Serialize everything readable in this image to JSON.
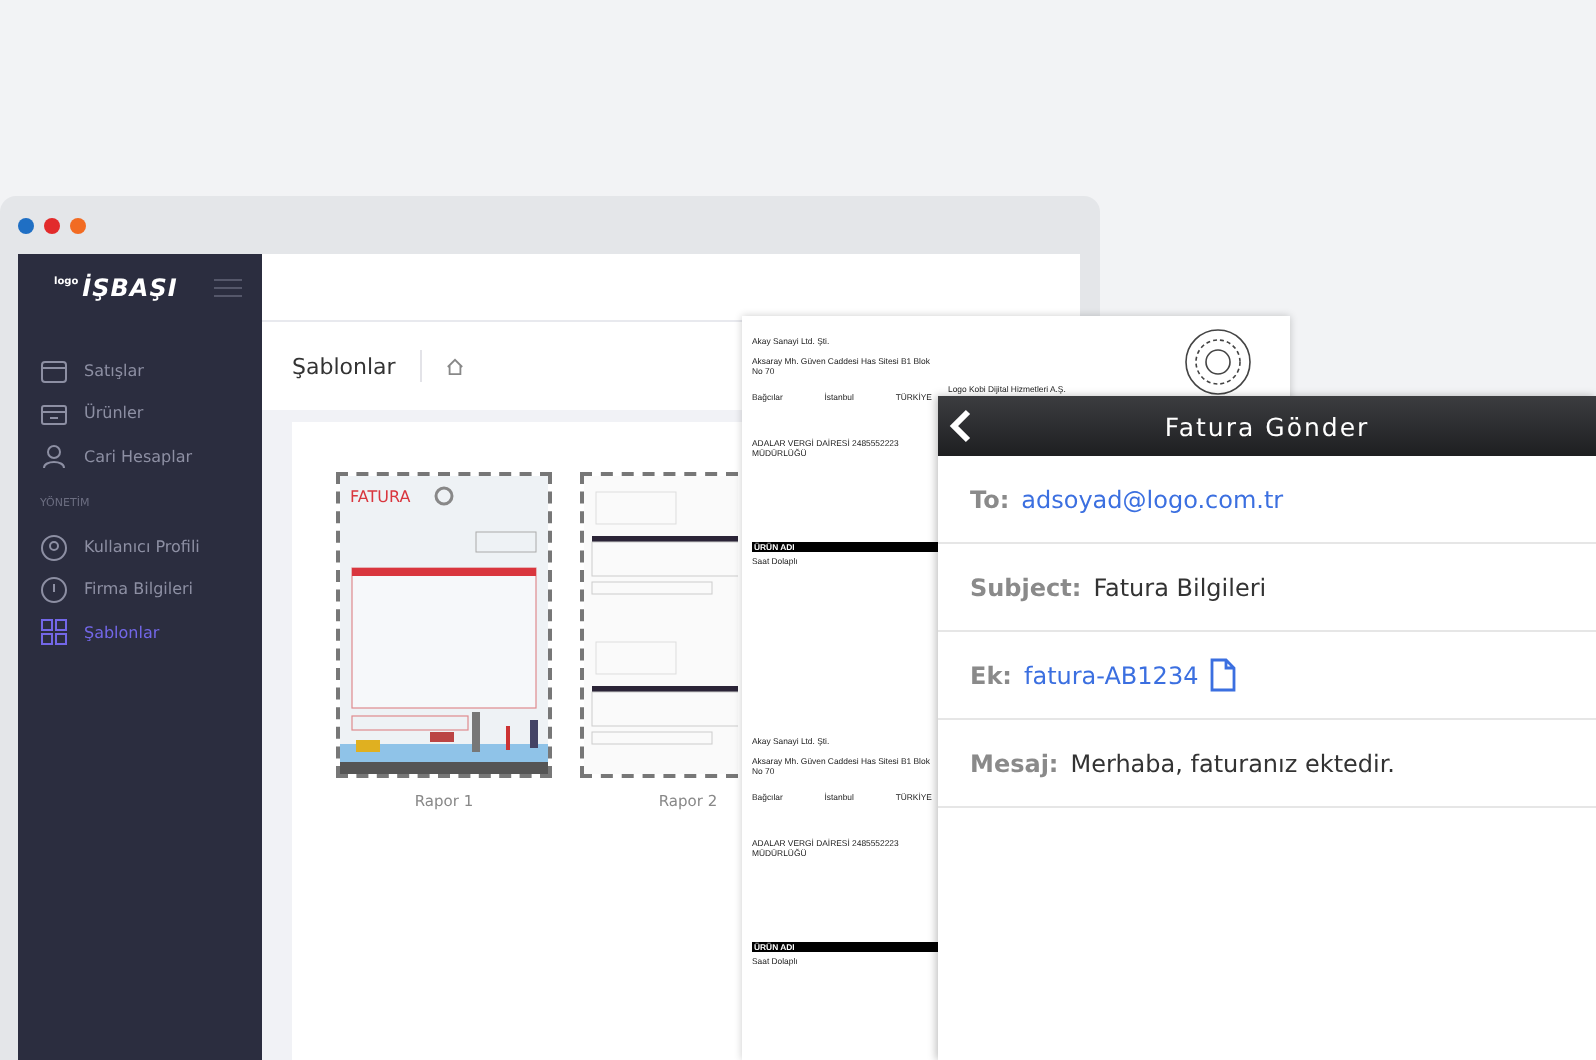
{
  "browser": {
    "logo_prefix": "logo",
    "logo": "İŞBAŞI",
    "nav": [
      {
        "label": "Satışlar",
        "selected": false
      },
      {
        "label": "Ürünler",
        "selected": false
      },
      {
        "label": "Cari Hesaplar",
        "selected": false
      }
    ],
    "section": "YÖNETİM",
    "nav_admin": [
      {
        "label": "Kullanıcı Profili",
        "selected": false
      },
      {
        "label": "Firma Bilgileri",
        "selected": false
      },
      {
        "label": "Şablonlar",
        "selected": true
      }
    ],
    "page_title": "Şablonlar",
    "templates": [
      {
        "name": "Rapor 1",
        "heading": "FATURA",
        "kind": "illustrated"
      },
      {
        "name": "Rapor 2",
        "kind": "plain"
      }
    ]
  },
  "document": {
    "recipient": "Logo Kobi Dijital Hizmetleri A.Ş.",
    "blocks": [
      {
        "company": "Akay Sanayi Ltd. Şti.",
        "address": "Aksaray Mh. Güven Caddesi Has Sitesi B1 Blok No 70",
        "district": "Bağcılar",
        "city": "İstanbul",
        "country": "TÜRKİYE",
        "tax_office": "ADALAR VERGİ DAİRESİ 2485552223 MÜDÜRLÜĞÜ",
        "product_header": "ÜRÜN ADI",
        "product": "Saat Dolaplı"
      },
      {
        "company": "Akay Sanayi Ltd. Şti.",
        "address": "Aksaray Mh. Güven Caddesi Has Sitesi B1 Blok No 70",
        "district": "Bağcılar",
        "city": "İstanbul",
        "country": "TÜRKİYE",
        "tax_office": "ADALAR VERGİ DAİRESİ 2485552223 MÜDÜRLÜĞÜ",
        "product_header": "ÜRÜN ADI",
        "product": "Saat Dolaplı"
      }
    ]
  },
  "mail": {
    "title": "Fatura Gönder",
    "fields": [
      {
        "label": "To:",
        "value": "adsoyad@logo.com.tr",
        "kind": "link"
      },
      {
        "label": "Subject:",
        "value": "Fatura Bilgileri",
        "kind": "text"
      },
      {
        "label": "Ek:",
        "value": "fatura-AB1234",
        "kind": "attachment"
      },
      {
        "label": "Mesaj:",
        "value": "Merhaba, faturanız ektedir.",
        "kind": "text"
      }
    ]
  }
}
